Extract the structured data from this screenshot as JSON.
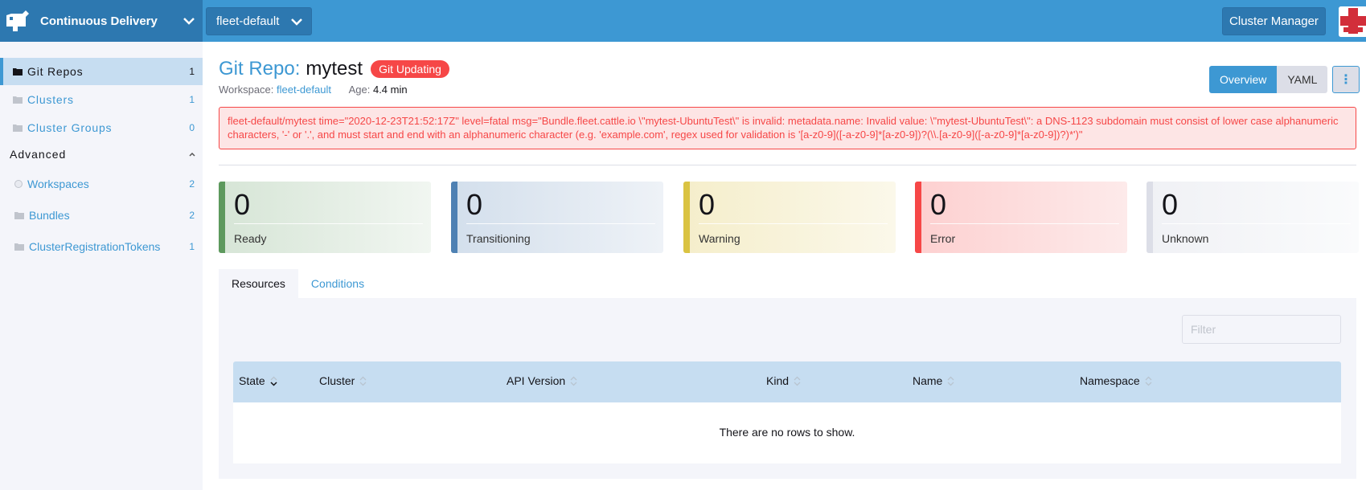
{
  "header": {
    "app_title": "Continuous Delivery",
    "workspace": "fleet-default",
    "cluster_manager": "Cluster Manager"
  },
  "sidebar": {
    "items": [
      {
        "label": "Git Repos",
        "count": "1"
      },
      {
        "label": "Clusters",
        "count": "1"
      },
      {
        "label": "Cluster Groups",
        "count": "0"
      }
    ],
    "group": "Advanced",
    "advanced": [
      {
        "label": "Workspaces",
        "count": "2"
      },
      {
        "label": "Bundles",
        "count": "2"
      },
      {
        "label": "ClusterRegistrationTokens",
        "count": "1"
      }
    ]
  },
  "page": {
    "title_prefix": "Git Repo:",
    "title_name": "mytest",
    "status_badge": "Git Updating",
    "workspace_label": "Workspace:",
    "workspace_value": "fleet-default",
    "age_label": "Age:",
    "age_value": "4.4 min",
    "view_overview": "Overview",
    "view_yaml": "YAML",
    "error_message": "fleet-default/mytest time=\"2020-12-23T21:52:17Z\" level=fatal msg=\"Bundle.fleet.cattle.io \\\"mytest-UbuntuTest\\\" is invalid: metadata.name: Invalid value: \\\"mytest-UbuntuTest\\\": a DNS-1123 subdomain must consist of lower case alphanumeric characters, '-' or '.', and must start and end with an alphanumeric character (e.g. 'example.com', regex used for validation is '[a-z0-9]([-a-z0-9]*[a-z0-9])?(\\\\.[a-z0-9]([-a-z0-9]*[a-z0-9])?)*')\""
  },
  "stats": [
    {
      "value": "0",
      "label": "Ready",
      "color": "#5d995d"
    },
    {
      "value": "0",
      "label": "Transitioning",
      "color": "#4f81b3"
    },
    {
      "value": "0",
      "label": "Warning",
      "color": "#dac342"
    },
    {
      "value": "0",
      "label": "Error",
      "color": "#f64747"
    },
    {
      "value": "0",
      "label": "Unknown",
      "color": "#dcdee7"
    }
  ],
  "tabs": [
    "Resources",
    "Conditions"
  ],
  "table": {
    "filter_placeholder": "Filter",
    "columns": [
      "State",
      "Cluster",
      "API Version",
      "Kind",
      "Name",
      "Namespace"
    ],
    "empty_text": "There are no rows to show."
  },
  "colors": {
    "accent": "#3d98d3",
    "header": "#3d98d3",
    "brand": "#2d78b0",
    "error": "#f64747"
  }
}
